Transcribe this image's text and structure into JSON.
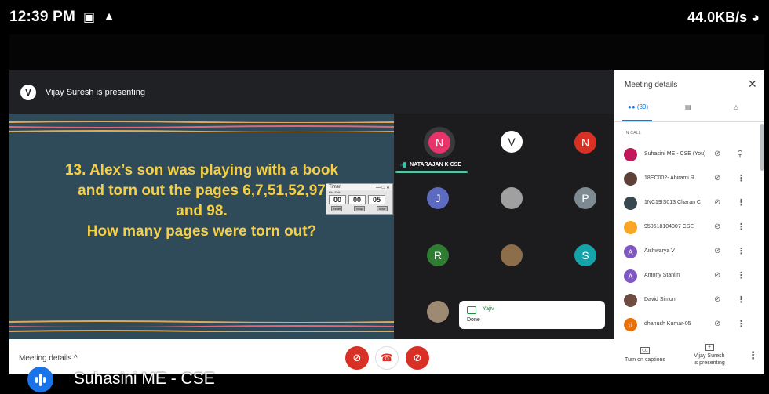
{
  "status_bar": {
    "time": "12:39 PM",
    "net_speed": "44.0KB/s"
  },
  "presenter_bar": {
    "avatar_letter": "V",
    "text": "Vijay Suresh is presenting"
  },
  "slide": {
    "question_lines": [
      "13. Alex’s son was playing with a book",
      "and torn out the pages 6,7,51,52,97",
      "and 98.",
      "How many pages were torn out?"
    ]
  },
  "timer": {
    "title": "Timer",
    "menu": "File Edit",
    "hours": "00",
    "minutes": "00",
    "seconds": "05",
    "buttons": [
      "Reset",
      "Stop",
      "Start"
    ]
  },
  "tiles": {
    "speaker_name": "NATARAJAN K CSE",
    "avatars": [
      {
        "letter": "N",
        "color": "#e8336b"
      },
      {
        "letter": "V",
        "color": "#ffffff"
      },
      {
        "letter": "N",
        "color": "#d93025"
      },
      {
        "letter": "J",
        "color": "#5c6bc0"
      },
      {
        "letter": "",
        "color": "#a0a0a0"
      },
      {
        "letter": "P",
        "color": "#7d8a91"
      },
      {
        "letter": "R",
        "color": "#2e7d32"
      },
      {
        "letter": "",
        "color": "#8d6e4a"
      },
      {
        "letter": "S",
        "color": "#12a4a8"
      },
      {
        "letter": "",
        "color": "#9e8a72"
      }
    ]
  },
  "chat_toast": {
    "name": "Yajiv",
    "message": "Done"
  },
  "panel": {
    "title": "Meeting details",
    "people_count": "(39)",
    "section_label": "IN CALL",
    "participants": [
      {
        "name": "Suhasini ME - CSE (You)",
        "avatar": "",
        "color": "#c2185b"
      },
      {
        "name": "18EC002- Abirami R",
        "avatar": "",
        "color": "#5d4037"
      },
      {
        "name": "1NC19IS013 Charan C",
        "avatar": "",
        "color": "#37474f"
      },
      {
        "name": "950618104007 CSE",
        "avatar": "",
        "color": "#f9a825"
      },
      {
        "name": "Aishwarya V",
        "avatar": "A",
        "color": "#7e57c2"
      },
      {
        "name": "Antony Stanlin",
        "avatar": "A",
        "color": "#7e57c2"
      },
      {
        "name": "David Simon",
        "avatar": "",
        "color": "#6d4c41"
      },
      {
        "name": "dhanush Kumar-05",
        "avatar": "d",
        "color": "#e8710a"
      }
    ]
  },
  "bottom_bar": {
    "meeting_details": "Meeting details",
    "captions_label": "Turn on captions",
    "present_line1": "Vijay Suresh",
    "present_line2": "is presenting"
  },
  "overlay": {
    "presenter_name": "Suhasini ME - CSE"
  },
  "colors": {
    "slide_bg": "#2f4a58",
    "slide_text": "#f5cf45",
    "end_call": "#d93025",
    "accent": "#1a73e8"
  }
}
